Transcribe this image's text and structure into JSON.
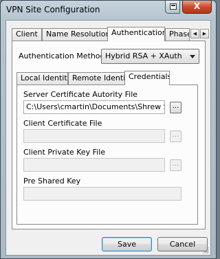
{
  "window": {
    "title": "VPN Site Configuration",
    "close_glyph": "X"
  },
  "tabs": [
    {
      "label": "Client",
      "active": false
    },
    {
      "label": "Name Resolution",
      "active": false
    },
    {
      "label": "Authentication",
      "active": true
    },
    {
      "label": "Phase",
      "active": false
    }
  ],
  "tab_scroll": {
    "left": "◀",
    "right": "▶"
  },
  "auth": {
    "method_label": "Authentication Method",
    "method_value": "Hybrid RSA + XAuth"
  },
  "subtabs": [
    {
      "label": "Local Identity",
      "active": false
    },
    {
      "label": "Remote Identity",
      "active": false
    },
    {
      "label": "Credentials",
      "active": true
    }
  ],
  "credentials": {
    "server_cert_label": "Server Certificate Autority File",
    "server_cert_value": "C:\\Users\\cmartin\\Documents\\Shrew Soft",
    "client_cert_label": "Client Certificate File",
    "client_cert_value": "",
    "client_key_label": "Client Private Key File",
    "client_key_value": "",
    "psk_label": "Pre Shared Key",
    "psk_value": "",
    "browse_label": "..."
  },
  "buttons": {
    "save": "Save",
    "cancel": "Cancel"
  },
  "colors": {
    "default_button_border": "#3c7fb1",
    "close_button": "#cc4a2a"
  }
}
